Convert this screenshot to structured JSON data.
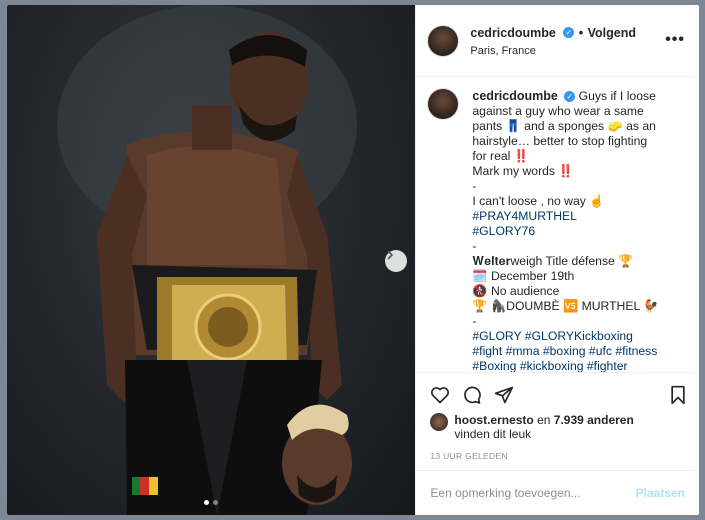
{
  "post": {
    "username": "cedricdoumbe",
    "follow_separator": "•",
    "follow_label": "Volgend",
    "location": "Paris, France",
    "more_label": "•••"
  },
  "caption": {
    "username": "cedricdoumbe",
    "lines": [
      "Guys if I loose",
      "against a guy who wear a same",
      "pants 👖 and a sponges 🧽 as an",
      "hairstyle… better to stop fighting",
      "for real ‼️",
      "Mark my words ‼️",
      "-",
      "I can't loose , no way ☝️",
      "#PRAY4MURTHEL",
      "#GLORY76",
      "-",
      "𝐖𝐞𝐥𝐭𝐞𝐫weigh Title défense 🏆",
      "🗓️ December 19th",
      "🚷 No audience",
      "🏆 🦍DOUMBÈ 🆚 MURTHEL 🐓",
      "-",
      "#GLORY #GLORYKickboxing",
      "#fight #mma #boxing #ufc #fitness",
      "#Boxing #kickboxing #fighter"
    ]
  },
  "likes": {
    "liker": "hoost.ernesto",
    "middle": " en ",
    "count": "7.939 anderen",
    "tail": "vinden dit leuk"
  },
  "time_ago": "13 UUR GELEDEN",
  "comment": {
    "placeholder": "Een opmerking toevoegen...",
    "post_label": "Plaatsen"
  },
  "carousel": {
    "count": 2,
    "active": 0
  },
  "colors": {
    "link": "#00376b",
    "verified": "#3897f0",
    "post_disabled": "#b2dffc"
  },
  "icons": [
    "heart-icon",
    "comment-icon",
    "share-icon",
    "bookmark-icon",
    "chevron-right-icon",
    "verified-icon"
  ]
}
